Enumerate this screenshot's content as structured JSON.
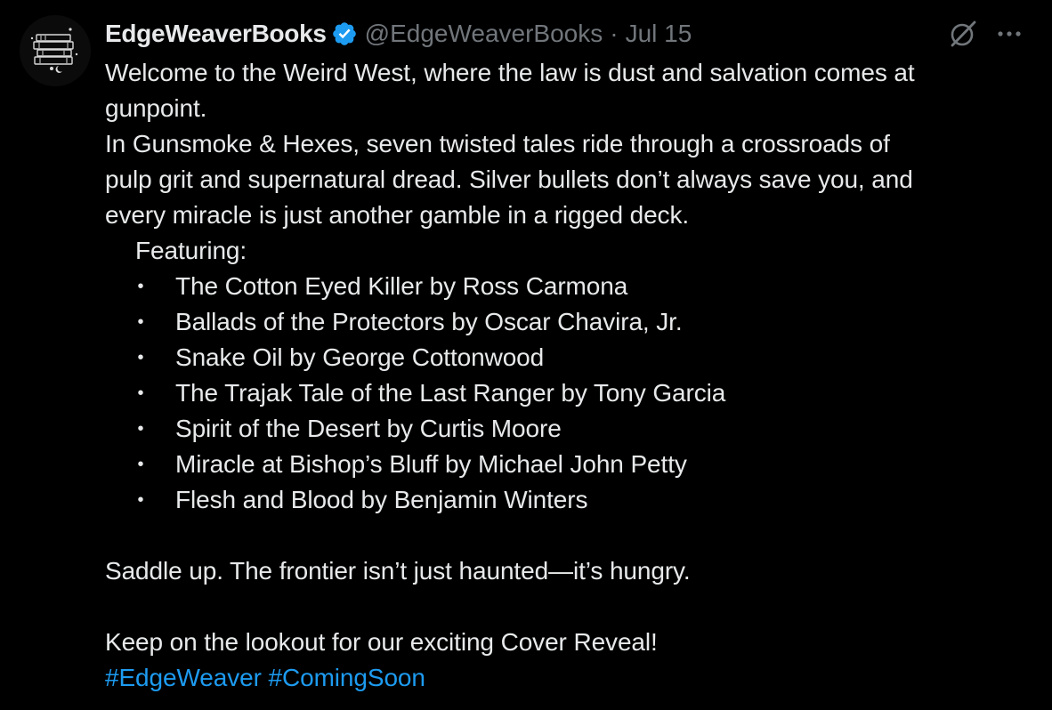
{
  "author": {
    "display_name": "EdgeWeaverBooks",
    "handle": "@EdgeWeaverBooks",
    "separator": "·",
    "date": "Jul 15",
    "verified": true,
    "avatar_icon": "book-stack-logo-icon"
  },
  "actions": {
    "grok_icon": "grok-icon",
    "more_icon": "more-horizontal-icon"
  },
  "body": {
    "line1": "Welcome to the Weird West, where the law is dust and salvation comes at",
    "line2": "gunpoint.",
    "line3": "In Gunsmoke & Hexes, seven twisted tales ride through a crossroads of",
    "line4": "pulp grit and supernatural dread. Silver bullets don’t always save you, and",
    "line5": "every miracle is just another gamble in a rigged deck.",
    "featuring": "Featuring:",
    "bullet_mark": "•",
    "stories": [
      "The Cotton Eyed Killer by Ross Carmona",
      "Ballads of the Protectors by Oscar Chavira, Jr.",
      "Snake Oil by George Cottonwood",
      "The Trajak Tale of the Last Ranger by Tony Garcia",
      "Spirit of the Desert by Curtis Moore",
      "Miracle at Bishop’s Bluff by Michael John Petty",
      "Flesh and Blood by Benjamin Winters"
    ],
    "saddle_line": "Saddle up. The frontier isn’t just haunted—it’s hungry.",
    "lookout_line": "Keep on the lookout for our exciting Cover Reveal!",
    "hashtags": [
      "#EdgeWeaver",
      "#ComingSoon"
    ]
  },
  "colors": {
    "background": "#000000",
    "text": "#e7e9ea",
    "muted": "#71767b",
    "link": "#1d9bf0",
    "verified": "#1d9bf0"
  }
}
